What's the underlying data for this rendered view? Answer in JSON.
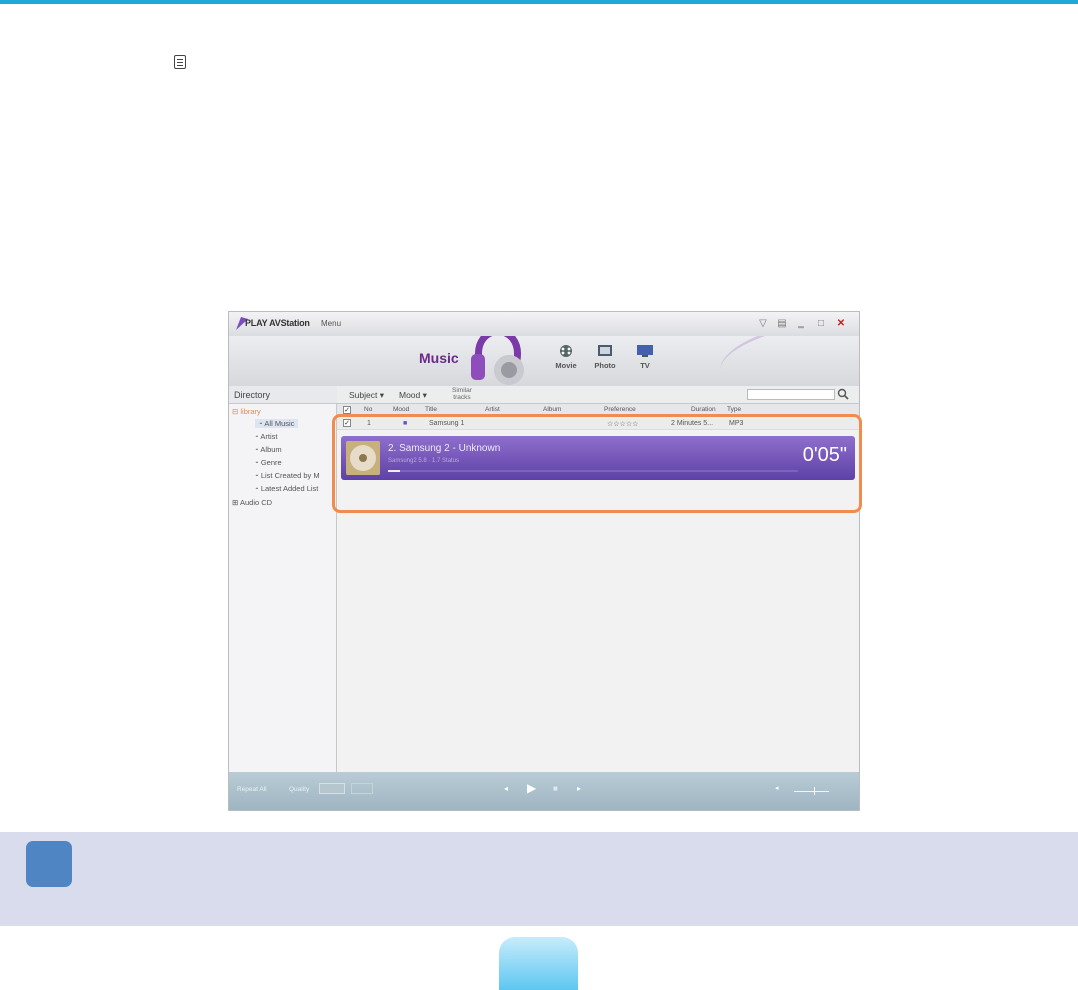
{
  "app": {
    "title": "PLAY AVStation",
    "menu_label": "Menu",
    "window_controls": [
      "filter-icon",
      "grid-icon",
      "minimize-icon",
      "maximize-icon",
      "close-icon"
    ],
    "nav": {
      "current": "Music",
      "items": [
        {
          "label": "Movie",
          "icon": "movie-icon"
        },
        {
          "label": "Photo",
          "icon": "photo-icon"
        },
        {
          "label": "TV",
          "icon": "tv-icon"
        }
      ]
    },
    "directory": {
      "header": "Directory",
      "root_label": "library",
      "items": [
        "All Music",
        "Artist",
        "Album",
        "Genre",
        "List Created by M",
        "Latest Added List"
      ],
      "audio_cd": "Audio CD"
    },
    "toolbar": {
      "subject": "Subject",
      "mood": "Mood",
      "similar_line1": "Similar",
      "similar_line2": "tracks",
      "search_icon": "search-icon"
    },
    "columns": [
      "No",
      "Mood",
      "Title",
      "Artist",
      "Album",
      "Preference",
      "Duration",
      "Type"
    ],
    "rows": [
      {
        "no": "1",
        "title": "Samsung 1",
        "preference": "☆☆☆☆☆",
        "duration": "2 Minutes 5...",
        "type": "MP3"
      }
    ],
    "now_playing": {
      "title": "2. Samsung 2 - Unknown",
      "subtitle": "Samsung2 5.8 · 1.7 Status",
      "time": "0'05\"",
      "progress_fraction": 0.03
    },
    "controls": {
      "repeat": "Repeat All",
      "quality": "Quality",
      "buttons": [
        "previous-icon",
        "play-icon",
        "stop-icon",
        "next-icon"
      ]
    }
  },
  "colors": {
    "top_rule": "#1ea8d8",
    "now_playing_bg": "#6c4fb5",
    "highlight_border": "#f08c50",
    "info_band": "#d8dcec",
    "info_icon": "#4e85c2",
    "page_tab": "#4fc2ef"
  }
}
